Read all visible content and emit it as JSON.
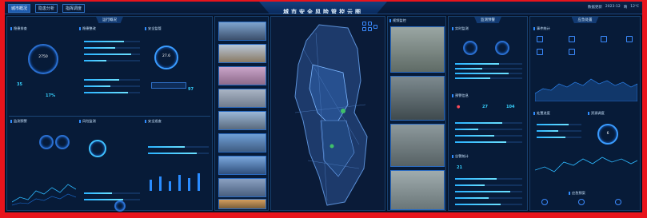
{
  "app": {
    "title": "城市安全风险管控云图",
    "tabs": [
      "城市概况",
      "隐患分析",
      "指挥调度"
    ],
    "status": [
      "数据更新",
      "2023-12",
      "晴",
      "12℃"
    ]
  },
  "left": {
    "panel_title": "运行概况",
    "sections": [
      "隐患排查",
      "隐患整改",
      "安全监管",
      "监测预警",
      "风险监测",
      "安全巡查"
    ],
    "rings": [
      "2750",
      "27.6",
      "77%"
    ],
    "numbers": [
      "35",
      "17%",
      "97"
    ]
  },
  "photos_col": {
    "label": "城市影像"
  },
  "map": {
    "label": "城市安全风险管控云图"
  },
  "cameras": {
    "title": "视频监控"
  },
  "right1": {
    "panel_title": "监测预警",
    "sections": [
      "实时监测",
      "预警信息",
      "告警统计"
    ],
    "numbers": [
      "27",
      "104",
      "21"
    ]
  },
  "right2": {
    "panel_title": "应急处置",
    "sections": [
      "事件统计",
      "处置进度",
      "资源调度",
      "应急预案"
    ],
    "numbers": [
      "6"
    ]
  },
  "colors": {
    "accent": "#2e8cff",
    "bg": "#061329",
    "frame": "#e8141c"
  }
}
